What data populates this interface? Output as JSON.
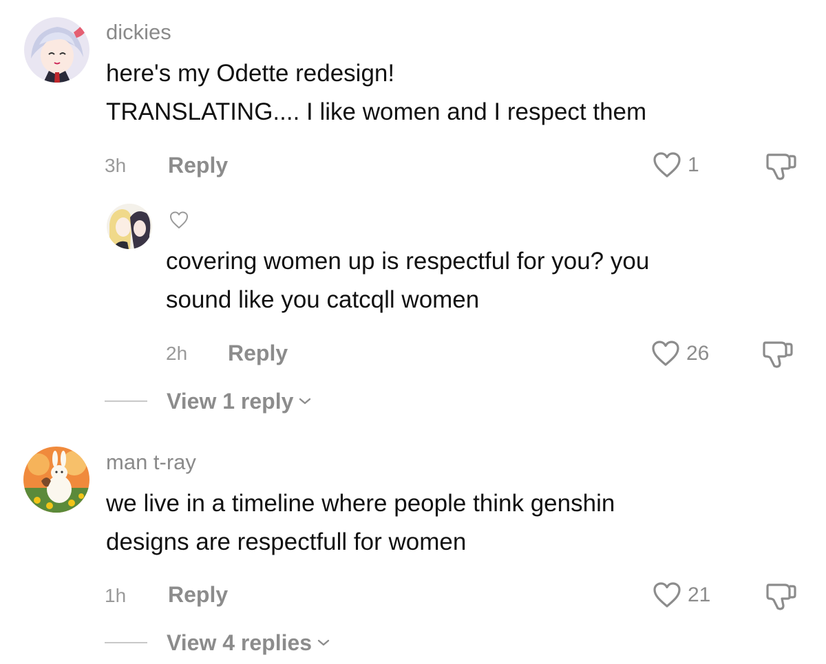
{
  "comments": [
    {
      "username": "dickies",
      "lines": [
        "here's my Odette redesign!",
        "TRANSLATING.... I like women and I respect them"
      ],
      "time": "3h",
      "reply_label": "Reply",
      "likes": "1",
      "icons": {
        "like": "heart-outline-icon",
        "dislike": "thumbs-down-icon"
      }
    },
    {
      "username": "man t-ray",
      "lines": [
        "we live in a timeline where people think genshin",
        "designs are respectfull for women"
      ],
      "time": "1h",
      "reply_label": "Reply",
      "likes": "21",
      "view_replies": "View 4 replies",
      "icons": {
        "like": "heart-outline-icon",
        "dislike": "thumbs-down-icon",
        "expand": "chevron-down-icon"
      }
    }
  ],
  "reply": {
    "lines": [
      "covering women up is respectful for you? you",
      "sound like you catcqll women"
    ],
    "time": "2h",
    "reply_label": "Reply",
    "likes": "26",
    "view_replies": "View 1 reply",
    "icons": {
      "creator_like": "small-heart-icon",
      "like": "heart-outline-icon",
      "dislike": "thumbs-down-icon",
      "expand": "chevron-down-icon"
    }
  },
  "colors": {
    "text": "#111111",
    "muted": "#8c8c8c",
    "divider": "#c8c8c8"
  }
}
